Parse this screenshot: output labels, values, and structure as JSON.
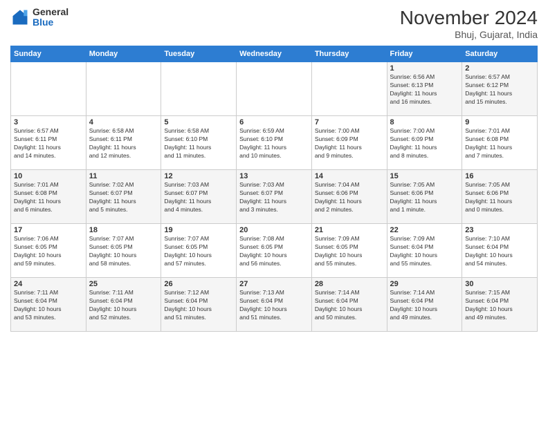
{
  "logo": {
    "general": "General",
    "blue": "Blue"
  },
  "header": {
    "month": "November 2024",
    "location": "Bhuj, Gujarat, India"
  },
  "weekdays": [
    "Sunday",
    "Monday",
    "Tuesday",
    "Wednesday",
    "Thursday",
    "Friday",
    "Saturday"
  ],
  "weeks": [
    [
      {
        "day": "",
        "info": ""
      },
      {
        "day": "",
        "info": ""
      },
      {
        "day": "",
        "info": ""
      },
      {
        "day": "",
        "info": ""
      },
      {
        "day": "",
        "info": ""
      },
      {
        "day": "1",
        "info": "Sunrise: 6:56 AM\nSunset: 6:13 PM\nDaylight: 11 hours\nand 16 minutes."
      },
      {
        "day": "2",
        "info": "Sunrise: 6:57 AM\nSunset: 6:12 PM\nDaylight: 11 hours\nand 15 minutes."
      }
    ],
    [
      {
        "day": "3",
        "info": "Sunrise: 6:57 AM\nSunset: 6:11 PM\nDaylight: 11 hours\nand 14 minutes."
      },
      {
        "day": "4",
        "info": "Sunrise: 6:58 AM\nSunset: 6:11 PM\nDaylight: 11 hours\nand 12 minutes."
      },
      {
        "day": "5",
        "info": "Sunrise: 6:58 AM\nSunset: 6:10 PM\nDaylight: 11 hours\nand 11 minutes."
      },
      {
        "day": "6",
        "info": "Sunrise: 6:59 AM\nSunset: 6:10 PM\nDaylight: 11 hours\nand 10 minutes."
      },
      {
        "day": "7",
        "info": "Sunrise: 7:00 AM\nSunset: 6:09 PM\nDaylight: 11 hours\nand 9 minutes."
      },
      {
        "day": "8",
        "info": "Sunrise: 7:00 AM\nSunset: 6:09 PM\nDaylight: 11 hours\nand 8 minutes."
      },
      {
        "day": "9",
        "info": "Sunrise: 7:01 AM\nSunset: 6:08 PM\nDaylight: 11 hours\nand 7 minutes."
      }
    ],
    [
      {
        "day": "10",
        "info": "Sunrise: 7:01 AM\nSunset: 6:08 PM\nDaylight: 11 hours\nand 6 minutes."
      },
      {
        "day": "11",
        "info": "Sunrise: 7:02 AM\nSunset: 6:07 PM\nDaylight: 11 hours\nand 5 minutes."
      },
      {
        "day": "12",
        "info": "Sunrise: 7:03 AM\nSunset: 6:07 PM\nDaylight: 11 hours\nand 4 minutes."
      },
      {
        "day": "13",
        "info": "Sunrise: 7:03 AM\nSunset: 6:07 PM\nDaylight: 11 hours\nand 3 minutes."
      },
      {
        "day": "14",
        "info": "Sunrise: 7:04 AM\nSunset: 6:06 PM\nDaylight: 11 hours\nand 2 minutes."
      },
      {
        "day": "15",
        "info": "Sunrise: 7:05 AM\nSunset: 6:06 PM\nDaylight: 11 hours\nand 1 minute."
      },
      {
        "day": "16",
        "info": "Sunrise: 7:05 AM\nSunset: 6:06 PM\nDaylight: 11 hours\nand 0 minutes."
      }
    ],
    [
      {
        "day": "17",
        "info": "Sunrise: 7:06 AM\nSunset: 6:05 PM\nDaylight: 10 hours\nand 59 minutes."
      },
      {
        "day": "18",
        "info": "Sunrise: 7:07 AM\nSunset: 6:05 PM\nDaylight: 10 hours\nand 58 minutes."
      },
      {
        "day": "19",
        "info": "Sunrise: 7:07 AM\nSunset: 6:05 PM\nDaylight: 10 hours\nand 57 minutes."
      },
      {
        "day": "20",
        "info": "Sunrise: 7:08 AM\nSunset: 6:05 PM\nDaylight: 10 hours\nand 56 minutes."
      },
      {
        "day": "21",
        "info": "Sunrise: 7:09 AM\nSunset: 6:05 PM\nDaylight: 10 hours\nand 55 minutes."
      },
      {
        "day": "22",
        "info": "Sunrise: 7:09 AM\nSunset: 6:04 PM\nDaylight: 10 hours\nand 55 minutes."
      },
      {
        "day": "23",
        "info": "Sunrise: 7:10 AM\nSunset: 6:04 PM\nDaylight: 10 hours\nand 54 minutes."
      }
    ],
    [
      {
        "day": "24",
        "info": "Sunrise: 7:11 AM\nSunset: 6:04 PM\nDaylight: 10 hours\nand 53 minutes."
      },
      {
        "day": "25",
        "info": "Sunrise: 7:11 AM\nSunset: 6:04 PM\nDaylight: 10 hours\nand 52 minutes."
      },
      {
        "day": "26",
        "info": "Sunrise: 7:12 AM\nSunset: 6:04 PM\nDaylight: 10 hours\nand 51 minutes."
      },
      {
        "day": "27",
        "info": "Sunrise: 7:13 AM\nSunset: 6:04 PM\nDaylight: 10 hours\nand 51 minutes."
      },
      {
        "day": "28",
        "info": "Sunrise: 7:14 AM\nSunset: 6:04 PM\nDaylight: 10 hours\nand 50 minutes."
      },
      {
        "day": "29",
        "info": "Sunrise: 7:14 AM\nSunset: 6:04 PM\nDaylight: 10 hours\nand 49 minutes."
      },
      {
        "day": "30",
        "info": "Sunrise: 7:15 AM\nSunset: 6:04 PM\nDaylight: 10 hours\nand 49 minutes."
      }
    ]
  ]
}
